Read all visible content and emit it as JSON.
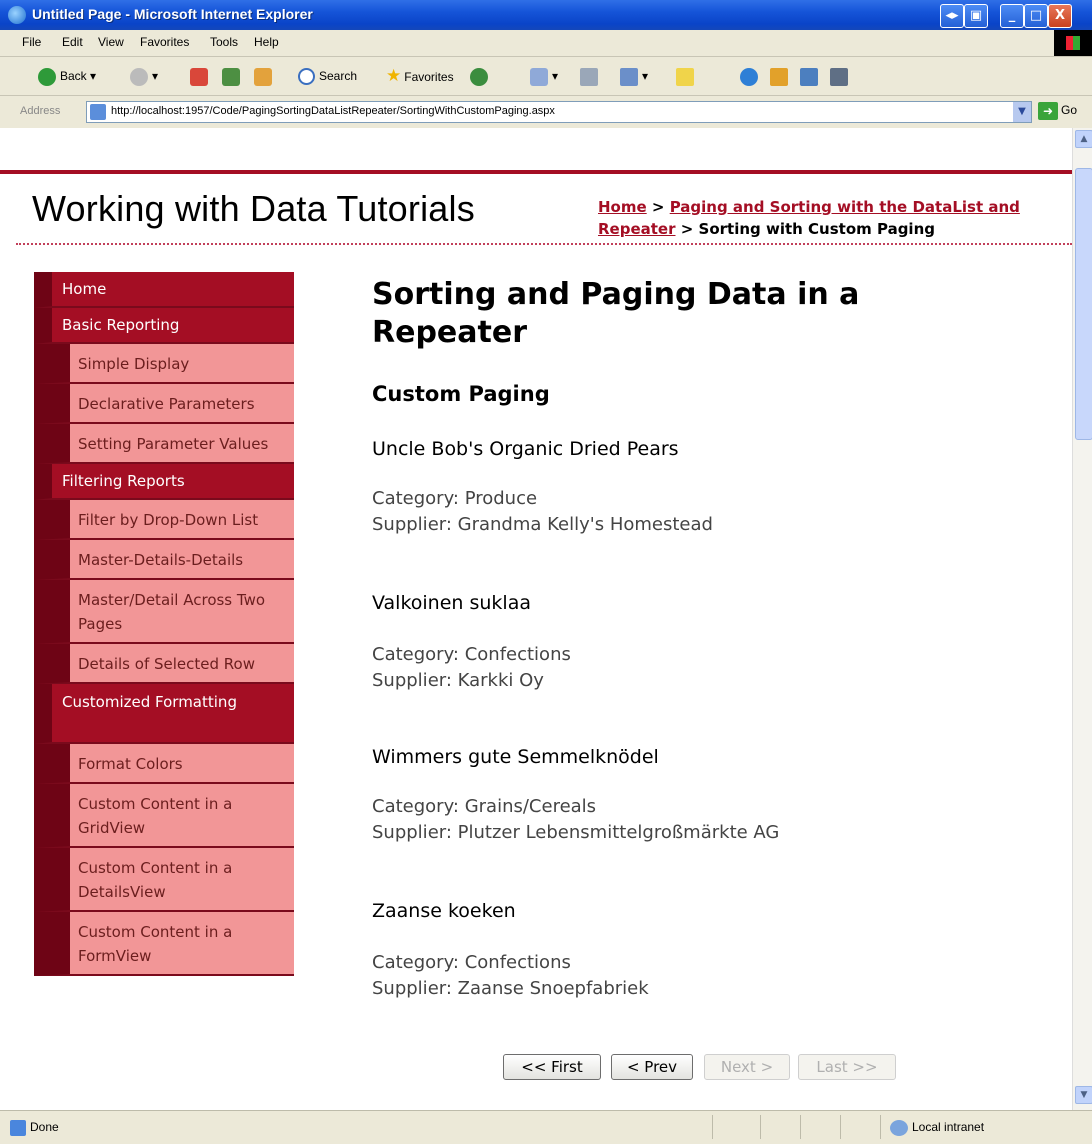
{
  "window": {
    "title": "Untitled Page - Microsoft Internet Explorer",
    "controls": [
      "◂▸",
      "▣",
      "_",
      "□",
      "X"
    ]
  },
  "menu": [
    "File",
    "Edit",
    "View",
    "Favorites",
    "Tools",
    "Help"
  ],
  "toolbar": {
    "back": "Back",
    "search": "Search",
    "favorites": "Favorites"
  },
  "address": {
    "label": "Address",
    "url": "http://localhost:1957/Code/PagingSortingDataListRepeater/SortingWithCustomPaging.aspx",
    "go": "Go"
  },
  "site": {
    "title": "Working with Data Tutorials",
    "breadcrumb": {
      "home": "Home",
      "sep1": " > ",
      "parent": "Paging and Sorting with the DataList and Repeater",
      "sep2": " > ",
      "current": "Sorting with Custom Paging"
    }
  },
  "sidebar": {
    "home": "Home",
    "basic_reporting": "Basic Reporting",
    "simple_display": "Simple Display",
    "declarative_parameters": "Declarative Parameters",
    "setting_parameter_values": "Setting Parameter Values",
    "filtering_reports": "Filtering Reports",
    "filter_dropdown": "Filter by Drop-Down List",
    "master_details_details": "Master-Details-Details",
    "master_detail_across": "Master/Detail Across Two Pages",
    "details_selected_row": "Details of Selected Row",
    "customized_formatting": "Customized Formatting",
    "format_colors": "Format Colors",
    "custom_gridview": "Custom Content in a GridView",
    "custom_detailsview": "Custom Content in a DetailsView",
    "custom_formview": "Custom Content in a FormView"
  },
  "main": {
    "heading": "Sorting and Paging Data in a Repeater",
    "subheading": "Custom Paging",
    "products": [
      {
        "name": "Uncle Bob's Organic Dried Pears",
        "category": "Category: Produce",
        "supplier": "Supplier: Grandma Kelly's Homestead"
      },
      {
        "name": "Valkoinen suklaa",
        "category": "Category: Confections",
        "supplier": "Supplier: Karkki Oy"
      },
      {
        "name": "Wimmers gute Semmelknödel",
        "category": "Category: Grains/Cereals",
        "supplier": "Supplier: Plutzer Lebensmittelgroßmärkte AG"
      },
      {
        "name": "Zaanse koeken",
        "category": "Category: Confections",
        "supplier": "Supplier: Zaanse Snoepfabriek"
      }
    ],
    "pager": {
      "first": "<< First",
      "prev": "< Prev",
      "next": "Next >",
      "last": "Last >>"
    }
  },
  "status": {
    "text": "Done",
    "zone": "Local intranet"
  },
  "colors": {
    "accent": "#a40e24",
    "sidebar_dark": "#6e0415",
    "sidebar_light": "#f29697"
  }
}
